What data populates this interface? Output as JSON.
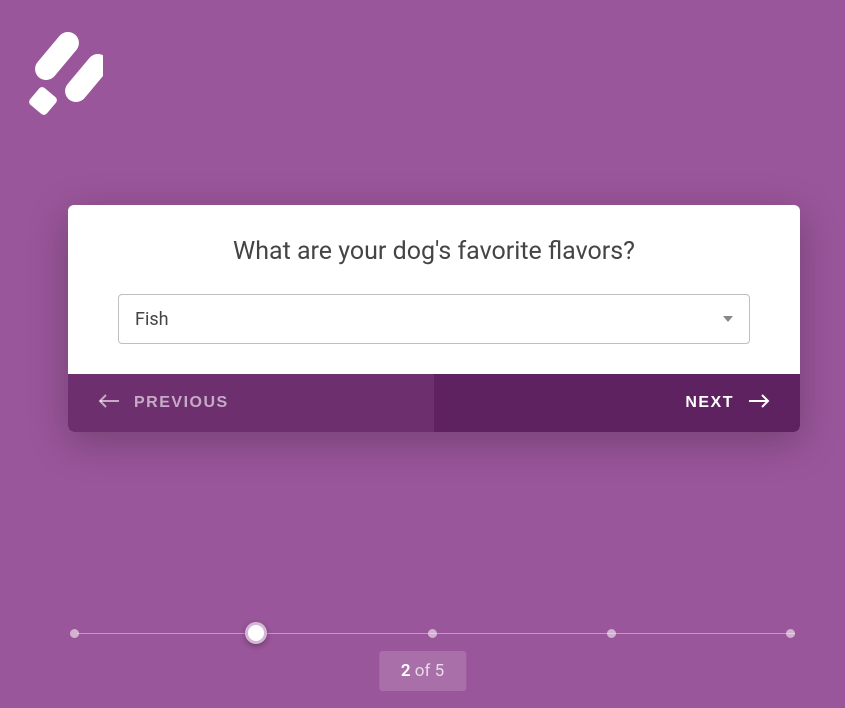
{
  "question": "What are your dog's favorite flavors?",
  "select": {
    "value": "Fish"
  },
  "nav": {
    "prev": "PREVIOUS",
    "next": "NEXT"
  },
  "progress": {
    "current": "2",
    "of_label": " of ",
    "total": "5",
    "steps": 5,
    "current_index": 1
  }
}
